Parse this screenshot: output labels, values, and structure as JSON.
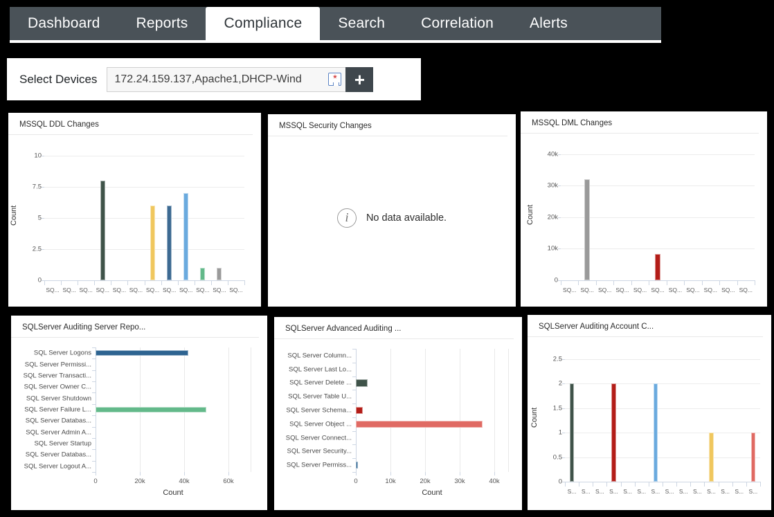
{
  "nav": {
    "tabs": [
      {
        "label": "Dashboard",
        "active": false
      },
      {
        "label": "Reports",
        "active": false
      },
      {
        "label": "Compliance",
        "active": true
      },
      {
        "label": "Search",
        "active": false
      },
      {
        "label": "Correlation",
        "active": false
      },
      {
        "label": "Alerts",
        "active": false
      }
    ]
  },
  "device_bar": {
    "label": "Select Devices",
    "input_value": "172.24.159.137,Apache1,DHCP-Wind",
    "input_placeholder": "Select Devices",
    "picker_icon": "broken-image-icon",
    "add_label": "+"
  },
  "panels": [
    {
      "id": "mssql-ddl-changes",
      "title": "MSSQL DDL Changes"
    },
    {
      "id": "mssql-security-changes",
      "title": "MSSQL Security Changes"
    },
    {
      "id": "mssql-dml-changes",
      "title": "MSSQL DML Changes"
    },
    {
      "id": "sqlserver-auditing-server-report",
      "title": "SQLServer Auditing Server Repo..."
    },
    {
      "id": "sqlserver-advanced-auditing",
      "title": "SQLServer Advanced Auditing ..."
    },
    {
      "id": "sqlserver-auditing-account-c",
      "title": "SQLServer Auditing Account C..."
    }
  ],
  "empty_state": {
    "icon": "info-icon",
    "glyph": "i",
    "message": "No data available."
  },
  "chart_data": [
    {
      "id": "mssql-ddl-changes",
      "type": "bar",
      "title": "MSSQL DDL Changes",
      "xlabel": "",
      "ylabel": "Count",
      "ylim": [
        0,
        10.8
      ],
      "yticks": [
        0,
        2.5,
        5,
        7.5,
        10
      ],
      "ytick_labels": [
        "0",
        "2.5",
        "5",
        "7.5",
        "10"
      ],
      "grid": true,
      "legend": "none",
      "categories": [
        "SQ...",
        "SQ...",
        "SQ...",
        "SQ...",
        "SQ...",
        "SQ...",
        "SQ...",
        "SQ...",
        "SQ...",
        "SQ...",
        "SQ...",
        "SQ..."
      ],
      "values": [
        0,
        0,
        0,
        8,
        0,
        0,
        6,
        6,
        7,
        1,
        1,
        0
      ],
      "colors": [
        "#3f5349",
        "#b31d18",
        "#6aaade",
        "#3f5349",
        "#b31d18",
        "#6aaade",
        "#f0c75e",
        "#3d6a92",
        "#6aaade",
        "#63b98a",
        "#9a9a9a",
        "#e06a63"
      ]
    },
    {
      "id": "mssql-security-changes",
      "type": "bar",
      "title": "MSSQL Security Changes",
      "categories": [],
      "values": [],
      "empty": true
    },
    {
      "id": "mssql-dml-changes",
      "type": "bar",
      "title": "MSSQL DML Changes",
      "xlabel": "",
      "ylabel": "Count",
      "ylim": [
        0,
        43000
      ],
      "yticks": [
        0,
        10000,
        20000,
        30000,
        40000
      ],
      "ytick_labels": [
        "0",
        "10k",
        "20k",
        "30k",
        "40k"
      ],
      "grid": true,
      "legend": "none",
      "categories": [
        "SQ...",
        "SQ...",
        "SQ...",
        "SQ...",
        "SQ...",
        "SQ...",
        "SQ...",
        "SQ...",
        "SQ...",
        "SQ...",
        "SQ..."
      ],
      "values": [
        0,
        32000,
        0,
        0,
        0,
        8300,
        0,
        0,
        0,
        0,
        0
      ],
      "colors": [
        "#3f5349",
        "#9a9a9a",
        "#6aaade",
        "#3f5349",
        "#b31d18",
        "#b31d18",
        "#f0c75e",
        "#3d6a92",
        "#6aaade",
        "#63b98a",
        "#9a9a9a"
      ]
    },
    {
      "id": "sqlserver-auditing-server-report",
      "type": "bar",
      "orientation": "horizontal",
      "title": "SQLServer Auditing Server Repo...",
      "xlabel": "Count",
      "ylabel": "",
      "xlim": [
        0,
        70000
      ],
      "xticks": [
        0,
        20000,
        40000,
        60000
      ],
      "xtick_labels": [
        "0",
        "20k",
        "40k",
        "60k"
      ],
      "grid": true,
      "legend": "none",
      "categories": [
        "SQL Server Logons",
        "SQL Server Permissi...",
        "SQL Server Transacti...",
        "SQL Server Owner C...",
        "SQL Server Shutdown",
        "SQL Server Failure L...",
        "SQL Server Databas...",
        "SQL Server Admin A...",
        "SQL Server Startup",
        "SQL Server Databas...",
        "SQL Server Logout A..."
      ],
      "values": [
        42000,
        0,
        0,
        0,
        0,
        50000,
        0,
        0,
        0,
        0,
        0
      ],
      "colors": [
        "#2e6491",
        "#b31d18",
        "#6aaade",
        "#3f5349",
        "#f0c75e",
        "#63b98a",
        "#9a9a9a",
        "#e06a63",
        "#3d6a92",
        "#b31d18",
        "#3f5349"
      ]
    },
    {
      "id": "sqlserver-advanced-auditing",
      "type": "bar",
      "orientation": "horizontal",
      "title": "SQLServer Advanced Auditing ...",
      "xlabel": "Count",
      "ylabel": "",
      "xlim": [
        0,
        44000
      ],
      "xticks": [
        0,
        10000,
        20000,
        30000,
        40000
      ],
      "xtick_labels": [
        "0",
        "10k",
        "20k",
        "30k",
        "40k"
      ],
      "grid": true,
      "legend": "none",
      "categories": [
        "SQL Server Column...",
        "SQL Server Last Lo...",
        "SQL Server Delete ...",
        "SQL Server Table U...",
        "SQL Server Schema...",
        "SQL Server Object ...",
        "SQL Server Connect...",
        "SQL Server Security...",
        "SQL Server Permiss..."
      ],
      "values": [
        0,
        0,
        3300,
        0,
        2000,
        36500,
        0,
        0,
        400
      ],
      "colors": [
        "#9a9a9a",
        "#f0c75e",
        "#3f5349",
        "#6aaade",
        "#b31d18",
        "#e06a63",
        "#63b98a",
        "#3d6a92",
        "#2e6491"
      ]
    },
    {
      "id": "sqlserver-auditing-account-c",
      "type": "bar",
      "title": "SQLServer Auditing Account C...",
      "xlabel": "",
      "ylabel": "Count",
      "ylim": [
        0,
        2.72
      ],
      "yticks": [
        0,
        0.5,
        1,
        1.5,
        2,
        2.5
      ],
      "ytick_labels": [
        "0",
        "0.5",
        "1",
        "1.5",
        "2",
        "2.5"
      ],
      "grid": true,
      "legend": "none",
      "categories": [
        "S...",
        "S...",
        "S...",
        "S...",
        "S...",
        "S...",
        "S...",
        "S...",
        "S...",
        "S...",
        "S...",
        "S...",
        "S...",
        "S..."
      ],
      "values": [
        2,
        0,
        0,
        2,
        0,
        0,
        2,
        0,
        0,
        0,
        1,
        0,
        0,
        1
      ],
      "colors": [
        "#3f5349",
        "#9a9a9a",
        "#63b98a",
        "#b31d18",
        "#f0c75e",
        "#3d6a92",
        "#6aaade",
        "#9a9a9a",
        "#3f5349",
        "#63b98a",
        "#f0c75e",
        "#b31d18",
        "#3d6a92",
        "#e06a63"
      ]
    }
  ]
}
